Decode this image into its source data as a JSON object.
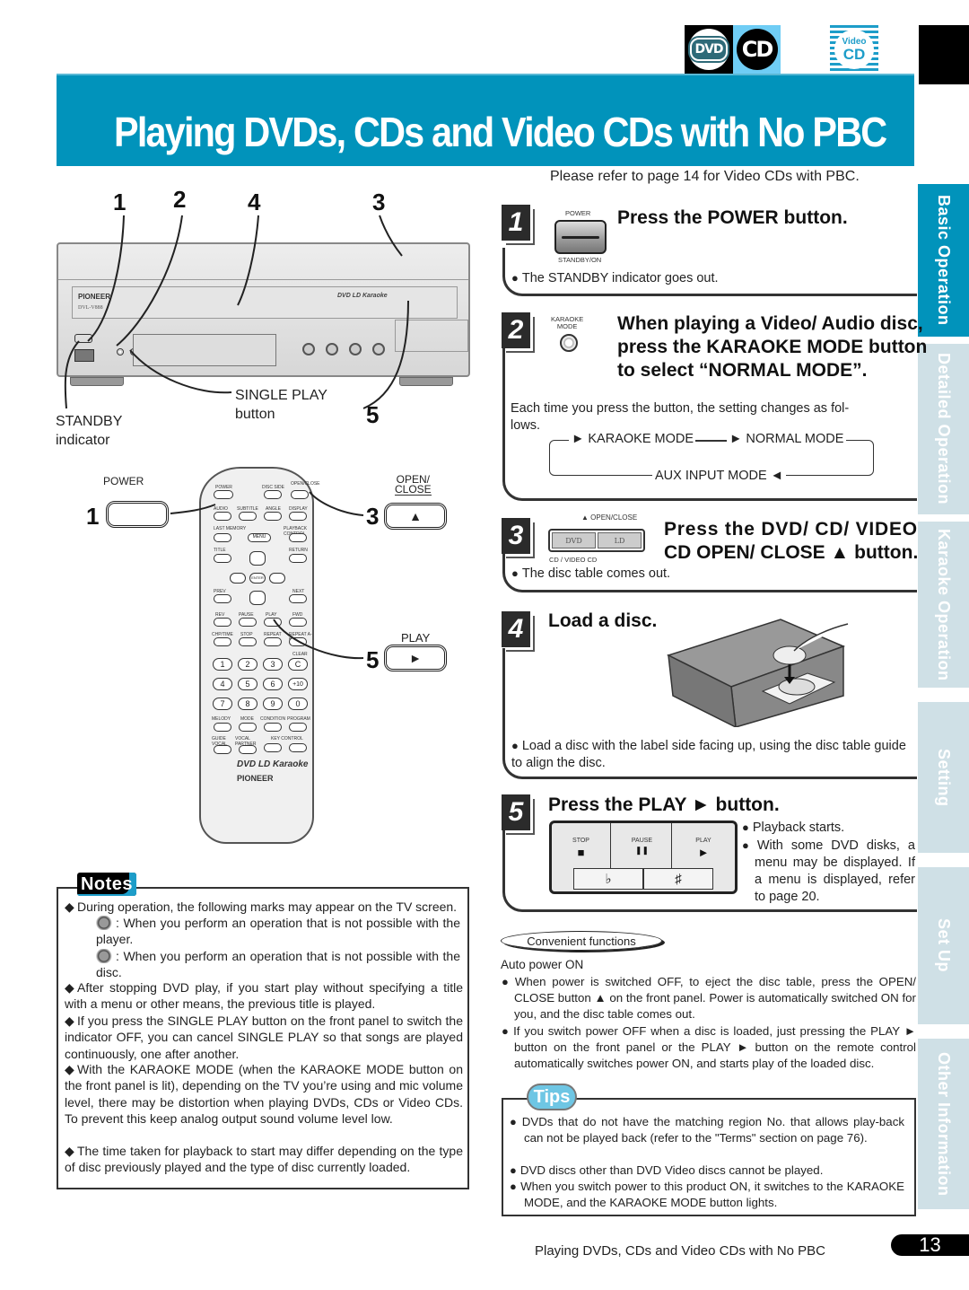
{
  "logos": {
    "dvd": "DVD",
    "cd": "CD",
    "video_cd_top": "Video",
    "video_cd_bottom": "CD"
  },
  "title": "Playing DVDs, CDs and Video CDs with No PBC",
  "refer_note": "Please refer to page 14 for Video CDs with PBC.",
  "side_tabs": [
    {
      "label": "Basic Operation",
      "active": true
    },
    {
      "label": "Detailed Operation",
      "active": false
    },
    {
      "label": "Karaoke Operation",
      "active": false
    },
    {
      "label": "Setting",
      "active": false
    },
    {
      "label": "Set Up",
      "active": false
    },
    {
      "label": "Other Information",
      "active": false
    }
  ],
  "illustration": {
    "callouts": [
      "1",
      "2",
      "4",
      "3",
      "5"
    ],
    "single_play_label": "SINGLE PLAY",
    "single_play_sub": "button",
    "standby_label": "STANDBY",
    "standby_sub": "indicator",
    "player_brand": "PIONEER",
    "player_model": "DVL-V888",
    "player_tagline": "DVD LD Karaoke",
    "remote": {
      "power_label": "POWER",
      "open_close_label_1": "OPEN/",
      "open_close_label_2": "CLOSE",
      "play_label": "PLAY",
      "callout_power": "1",
      "callout_open": "3",
      "callout_play": "5",
      "open_glyph": "▲",
      "play_glyph": "►",
      "buttons_row1": [
        "POWER",
        "DISC SIDE",
        "OPEN/CLOSE"
      ],
      "buttons_row2": [
        "AUDIO",
        "SUBTITLE",
        "ANGLE",
        "DISPLAY"
      ],
      "buttons_row3": [
        "LAST MEMORY",
        "MENU",
        "PLAYBACK CONTROL"
      ],
      "buttons_row4": [
        "TITLE",
        "RETURN"
      ],
      "enter": "ENTER",
      "buttons_row5": [
        "PREV",
        "NEXT"
      ],
      "buttons_row6": [
        "REV",
        "PAUSE",
        "PLAY",
        "FWD"
      ],
      "buttons_row7": [
        "CHP/TIME",
        "STOP",
        "REPEAT",
        "REPEAT A-B"
      ],
      "clear": "CLEAR",
      "digits": [
        "1",
        "2",
        "3",
        "C",
        "4",
        "5",
        "6",
        "+10",
        "7",
        "8",
        "9",
        "0"
      ],
      "buttons_row8": [
        "MELODY",
        "MODE",
        "CONDITION",
        "PROGRAM"
      ],
      "buttons_row9": [
        "GUIDE VOCAL",
        "VOCAL PARTNER",
        "KEY CONTROL"
      ],
      "brand_line": "DVD LD Karaoke",
      "brand": "PIONEER"
    }
  },
  "steps": [
    {
      "number": "1",
      "title": "Press the POWER button.",
      "button_top_label": "POWER",
      "button_bottom_label": "STANDBY/ON",
      "bullets": [
        "The STANDBY indicator goes out."
      ]
    },
    {
      "number": "2",
      "title_line1": "When playing a Video/ Audio disc,",
      "title_line2": "press the KARAOKE MODE button",
      "title_line3": "to select “NORMAL MODE”.",
      "button_label_1": "KARAOKE",
      "button_label_2": "MODE",
      "body_line1": "Each time you press the button, the setting changes as fol-",
      "body_line2": "lows.",
      "cycle": [
        "KARAOKE MODE",
        "NORMAL MODE",
        "AUX INPUT MODE"
      ]
    },
    {
      "number": "3",
      "title_line1": "Press the DVD/ CD/ VIDEO",
      "title_line2": "CD OPEN/ CLOSE ▲ button.",
      "button_top_label": "▲ OPEN/CLOSE",
      "button_left": "DVD",
      "button_right": "LD",
      "button_bottom_label": "CD / VIDEO CD",
      "bullets": [
        "The disc table comes out."
      ]
    },
    {
      "number": "4",
      "title": "Load a disc.",
      "bullets": [
        "Load a disc with the label side facing up, using the disc table guide to align the disc."
      ]
    },
    {
      "number": "5",
      "title": "Press the PLAY ► button.",
      "panel": {
        "stop": "STOP",
        "pause": "PAUSE",
        "play": "PLAY",
        "stop_glyph": "■",
        "pause_glyph": "❚❚",
        "play_glyph": "►",
        "flat": "♭",
        "sharp": "♯"
      },
      "bullets": [
        "Playback starts.",
        "With some DVD disks, a menu may be displayed. If a menu is displayed, refer to page 20."
      ]
    }
  ],
  "notes": {
    "tag": "Notes",
    "items": [
      "During operation, the following marks may appear on the TV screen.",
      "After stopping DVD play, if you start play without specifying a title with a menu or other means, the previous title is played.",
      "If you press the SINGLE PLAY button on the front panel to switch the indicator OFF, you can cancel SINGLE PLAY so that songs are played continuously, one after another.",
      "With the KARAOKE MODE (when the KARAOKE MODE button on the front panel is lit), depending on the TV you’re using and mic volume level, there may be distortion when playing DVDs, CDs or Video CDs. To prevent this keep analog output sound volume level low.",
      "The time taken for playback to start may differ depending on the type of disc previously played and the type of disc currently loaded."
    ],
    "sub_items": [
      ": When you perform an operation that is not possible with the player.",
      ": When you perform an operation that is not possible with the disc."
    ]
  },
  "convenient": {
    "tag": "Convenient functions",
    "heading": "Auto power ON",
    "items": [
      "When power is switched OFF, to eject the disc table, press the OPEN/ CLOSE button ▲ on the front panel. Power is automatically switched ON for you, and the disc table comes out.",
      "If you switch power OFF when a disc is loaded, just pressing the PLAY ► button on the front panel or the PLAY ► button on the remote control automatically switches power ON, and starts play of the loaded disc."
    ]
  },
  "tips": {
    "tag": "Tips",
    "items": [
      "DVDs that do not have the matching region No. that allows play-back can not be played back (refer to the \"Terms\" section on page 76).",
      "DVD discs other than DVD Video discs cannot be played.",
      "When you switch power to this product ON, it switches to the KARAOKE MODE, and the KARAOKE MODE button lights."
    ]
  },
  "footer": {
    "title": "Playing DVDs, CDs and Video CDs with No PBC",
    "page": "13"
  },
  "colors": {
    "accent": "#0193bb",
    "tab_inactive": "#cfe0e6",
    "tips": "#6ec6e4"
  }
}
